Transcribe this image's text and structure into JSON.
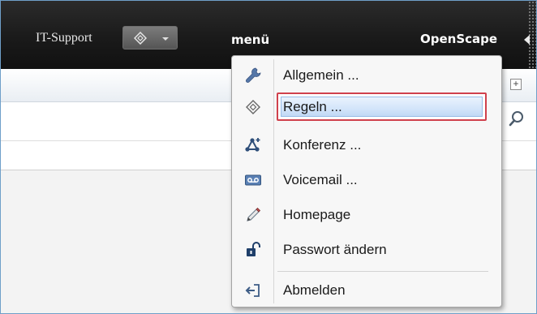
{
  "header": {
    "user_name": "IT-Support",
    "menu_label": "menü",
    "brand": "OpenScape"
  },
  "icons": {
    "status": "diamond-status-icon",
    "expand": "plus-icon",
    "search": "magnifier-icon"
  },
  "menu": {
    "items": [
      {
        "label": "Allgemein ...",
        "icon": "wrench-icon",
        "selected": false
      },
      {
        "label": "Regeln ...",
        "icon": "diamond-icon",
        "selected": true
      },
      {
        "label": "Konferenz ...",
        "icon": "conference-icon",
        "selected": false
      },
      {
        "label": "Voicemail ...",
        "icon": "voicemail-icon",
        "selected": false
      },
      {
        "label": "Homepage",
        "icon": "pencil-icon",
        "selected": false
      },
      {
        "label": "Passwort ändern",
        "icon": "padlock-icon",
        "selected": false
      },
      {
        "label": "Abmelden",
        "icon": "logout-icon",
        "selected": false
      }
    ]
  },
  "colors": {
    "header_bg": "#1a1a1a",
    "selection_border": "#d0414d",
    "selection_fill": "#d3e5fa",
    "frame_border": "#6f9fc9"
  }
}
